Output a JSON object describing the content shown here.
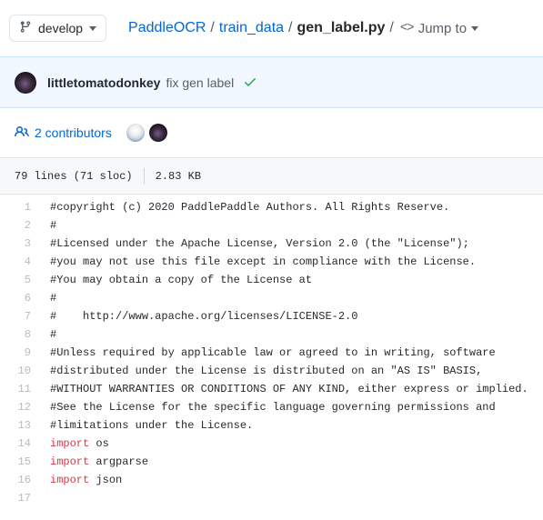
{
  "topbar": {
    "branch_button": {
      "label": "develop",
      "icon": "git-branch-icon",
      "caret_icon": "chevron-down-icon"
    },
    "breadcrumb": {
      "repo": "PaddleOCR",
      "folder": "train_data",
      "file": "gen_label.py",
      "separator": "/",
      "jump_to_label": "Jump to",
      "jump_to_icon": "code-angle-icon",
      "jump_to_caret": "chevron-down-icon"
    }
  },
  "commit": {
    "author": "littletomatodonkey",
    "message": "fix gen label",
    "status_icon": "check-icon",
    "status_color": "#28a745",
    "avatar_icon": "avatar",
    "background_color": "#f1f8ff"
  },
  "contributors": {
    "icon": "people-icon",
    "label": "2 contributors",
    "count": 2,
    "avatars": [
      "avatar-duck",
      "avatar-dark"
    ]
  },
  "file_meta": {
    "lines": "79 lines (71 sloc)",
    "size": "2.83 KB"
  },
  "code": {
    "language": "python",
    "accent_keyword_color": "#d73a49",
    "lines": [
      {
        "n": "1",
        "tokens": [
          {
            "t": "#copyright (c) 2020 PaddlePaddle Authors. All Rights Reserve.",
            "c": "cm"
          }
        ]
      },
      {
        "n": "2",
        "tokens": [
          {
            "t": "#",
            "c": "cm"
          }
        ]
      },
      {
        "n": "3",
        "tokens": [
          {
            "t": "#Licensed under the Apache License, Version 2.0 (the \"License\");",
            "c": "cm"
          }
        ]
      },
      {
        "n": "4",
        "tokens": [
          {
            "t": "#you may not use this file except in compliance with the License.",
            "c": "cm"
          }
        ]
      },
      {
        "n": "5",
        "tokens": [
          {
            "t": "#You may obtain a copy of the License at",
            "c": "cm"
          }
        ]
      },
      {
        "n": "6",
        "tokens": [
          {
            "t": "#",
            "c": "cm"
          }
        ]
      },
      {
        "n": "7",
        "tokens": [
          {
            "t": "#    http://www.apache.org/licenses/LICENSE-2.0",
            "c": "cm"
          }
        ]
      },
      {
        "n": "8",
        "tokens": [
          {
            "t": "#",
            "c": "cm"
          }
        ]
      },
      {
        "n": "9",
        "tokens": [
          {
            "t": "#Unless required by applicable law or agreed to in writing, software",
            "c": "cm"
          }
        ]
      },
      {
        "n": "10",
        "tokens": [
          {
            "t": "#distributed under the License is distributed on an \"AS IS\" BASIS,",
            "c": "cm"
          }
        ]
      },
      {
        "n": "11",
        "tokens": [
          {
            "t": "#WITHOUT WARRANTIES OR CONDITIONS OF ANY KIND, either express or implied.",
            "c": "cm"
          }
        ]
      },
      {
        "n": "12",
        "tokens": [
          {
            "t": "#See the License for the specific language governing permissions and",
            "c": "cm"
          }
        ]
      },
      {
        "n": "13",
        "tokens": [
          {
            "t": "#limitations under the License.",
            "c": "cm"
          }
        ]
      },
      {
        "n": "14",
        "tokens": [
          {
            "t": "import",
            "c": "kw"
          },
          {
            "t": " os",
            "c": "pl"
          }
        ]
      },
      {
        "n": "15",
        "tokens": [
          {
            "t": "import",
            "c": "kw"
          },
          {
            "t": " argparse",
            "c": "pl"
          }
        ]
      },
      {
        "n": "16",
        "tokens": [
          {
            "t": "import",
            "c": "kw"
          },
          {
            "t": " json",
            "c": "pl"
          }
        ]
      },
      {
        "n": "17",
        "tokens": [
          {
            "t": "",
            "c": "pl"
          }
        ]
      }
    ]
  }
}
